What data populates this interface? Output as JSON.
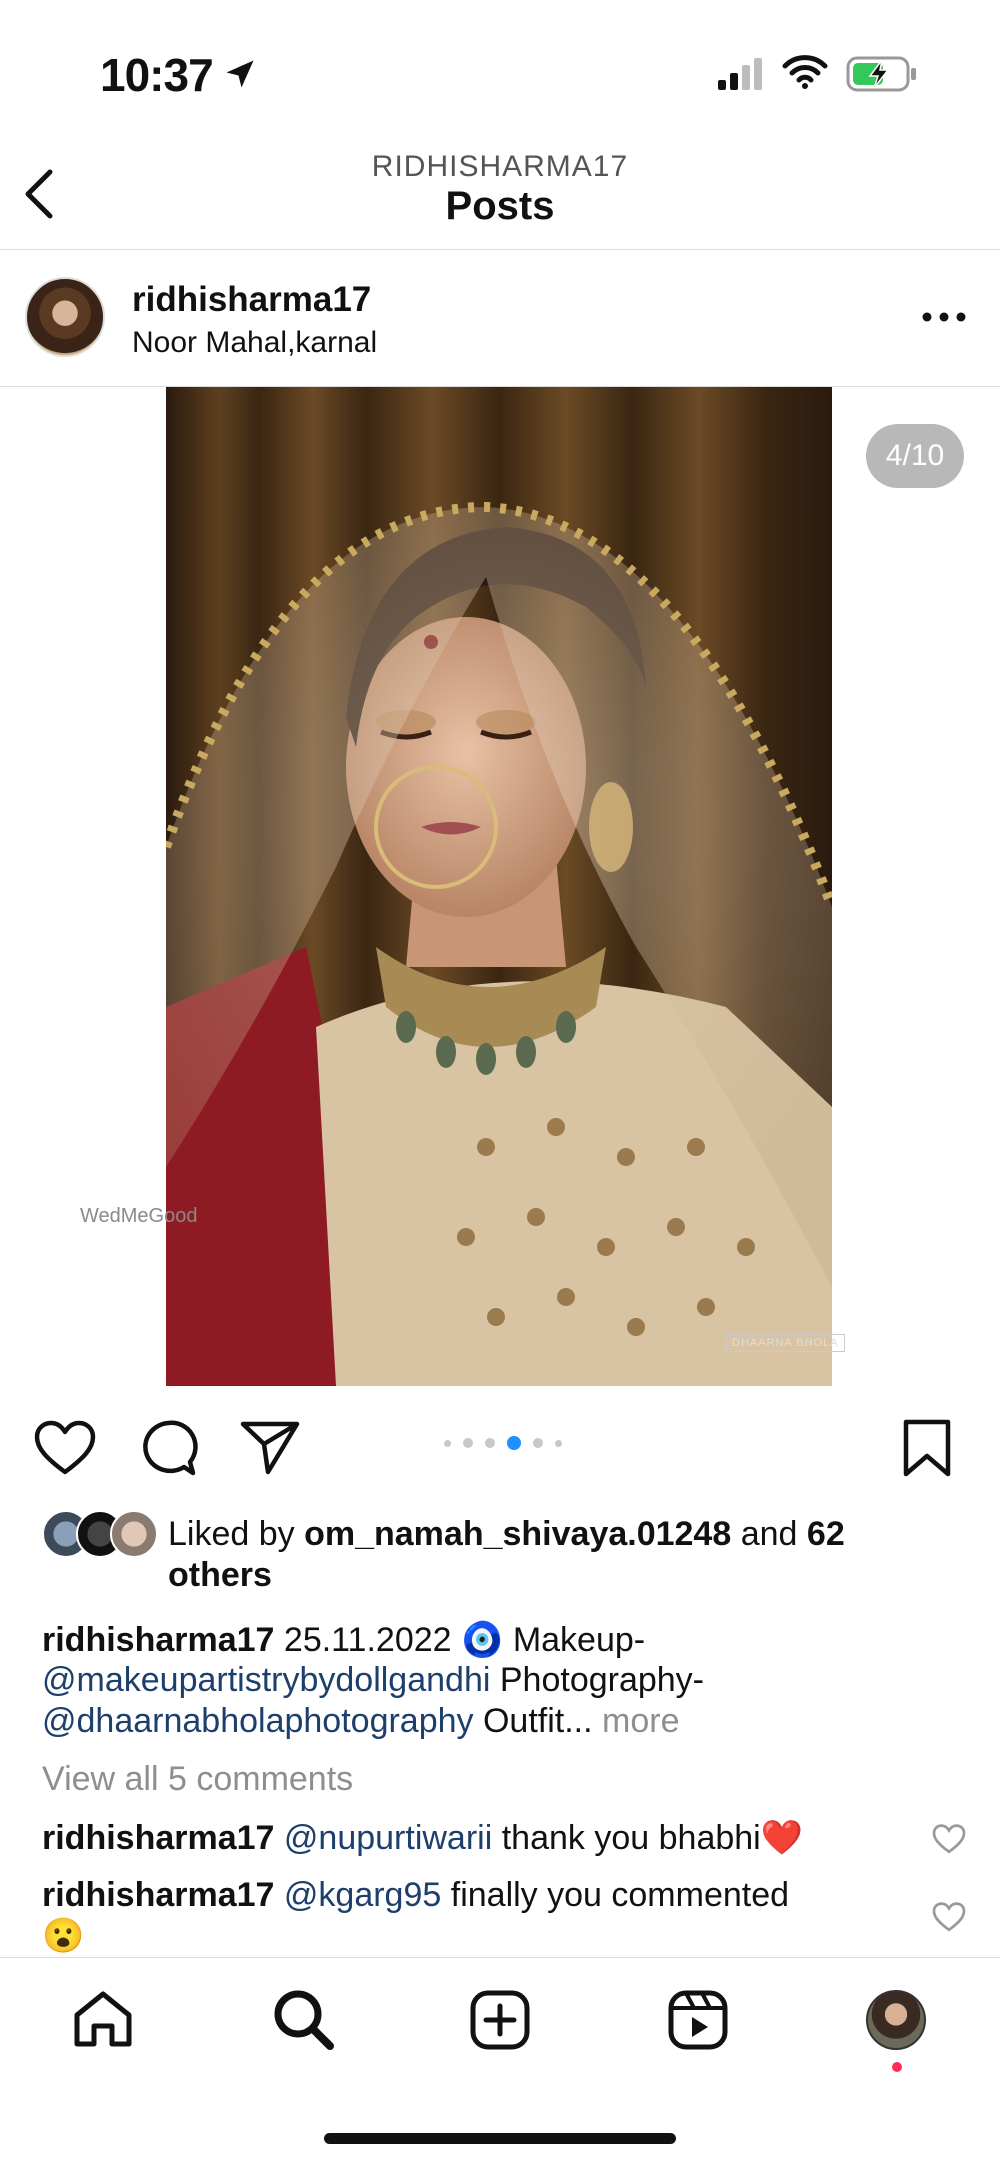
{
  "status_bar": {
    "time": "10:37"
  },
  "header": {
    "subtitle": "RIDHISHARMA17",
    "title": "Posts"
  },
  "post": {
    "username": "ridhisharma17",
    "location": "Noor Mahal,karnal",
    "counter": "4/10",
    "watermark": "WedMeGood",
    "photo_credit": "DHAARNA BHOLA",
    "carousel": {
      "count": 6,
      "active_index": 3
    }
  },
  "likes": {
    "prefix": "Liked by",
    "user": "om_namah_shivaya.01248",
    "middle": "and",
    "others": "62 others"
  },
  "caption": {
    "username": "ridhisharma17",
    "date": "25.11.2022",
    "emoji": "🧿",
    "makeup_label": "Makeup-",
    "makeup_link": "@makeupartistrybydollgandhi",
    "photo_label": "Photography-",
    "photo_link": "@dhaarnabholaphotography",
    "outfit": "Outfit...",
    "more": "more"
  },
  "view_comments": "View all 5 comments",
  "comments": [
    {
      "username": "ridhisharma17",
      "mention": "@nupurtiwarii",
      "text": "thank you bhabhi❤️"
    },
    {
      "username": "ridhisharma17",
      "mention": "@kgarg95",
      "text": "finally you commented",
      "text2": "😮"
    }
  ],
  "tabs": [
    "home-icon",
    "search-icon",
    "create-icon",
    "reels-icon",
    "profile-avatar"
  ]
}
